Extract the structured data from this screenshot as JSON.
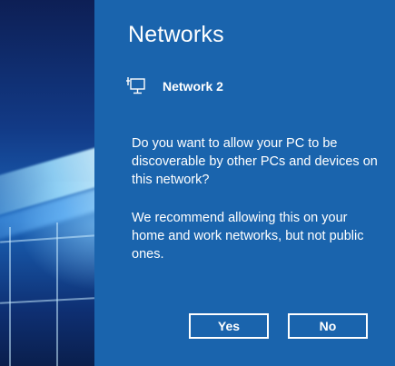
{
  "flyout": {
    "title": "Networks",
    "network": {
      "icon": "wired-network-icon",
      "name": "Network 2"
    },
    "question": "Do you want to allow your PC to be discoverable by other PCs and devices on this network?",
    "recommendation": "We recommend allowing this on your home and work networks, but not public ones.",
    "buttons": {
      "yes_label": "Yes",
      "no_label": "No"
    }
  },
  "colors": {
    "panel_background": "#1a64ad",
    "text": "#ffffff"
  }
}
